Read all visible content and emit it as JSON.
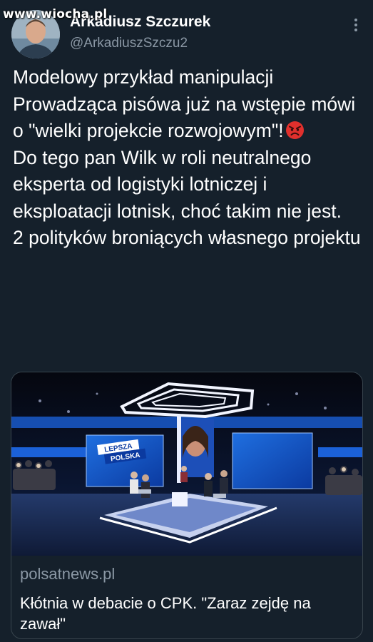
{
  "watermark": "www.wiocha.pl",
  "author": {
    "display_name": "Arkadiusz Szczurek",
    "handle": "@ArkadiuszSzczu2"
  },
  "tweet": {
    "lines": [
      "Modelowy przykład manipulacji",
      "Prowadząca pisówa już na wstępie mówi o \"wielki projekcie rozwojowym\"!",
      "Do tego pan Wilk w roli neutralnego eksperta od logistyki lotniczej i eksploatacji lotnisk, choć takim nie jest.",
      "2 polityków broniących własnego projektu"
    ],
    "emoji": "angry-face-icon"
  },
  "card": {
    "image_logo_line1": "LEPSZA",
    "image_logo_line2": "POLSKA",
    "domain": "polsatnews.pl",
    "title": "Kłótnia w debacie o CPK. \"Zaraz zejdę na zawał\""
  },
  "colors": {
    "background": "#15202b",
    "text": "#ffffff",
    "secondary": "#8b98a5",
    "border": "#38444d"
  }
}
